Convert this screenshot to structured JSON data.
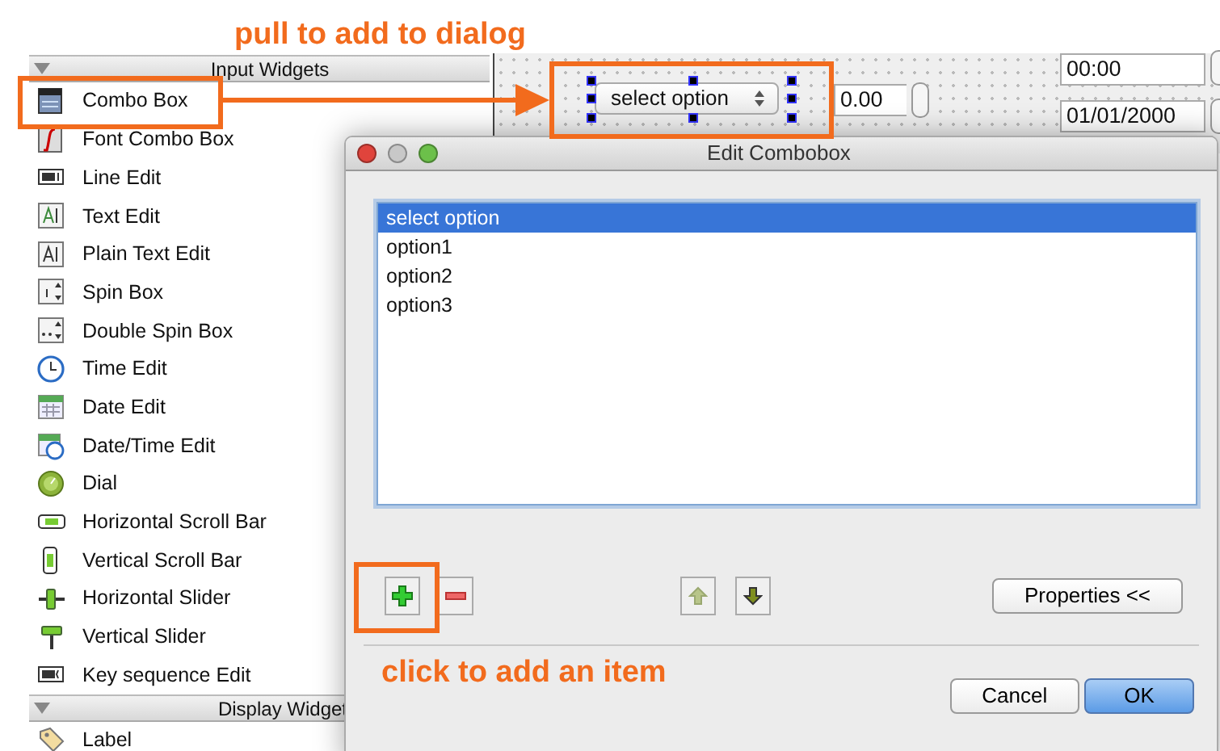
{
  "annotations": [
    {
      "text": "pull to add to dialog"
    },
    {
      "text": "click to add an item"
    }
  ],
  "widget_box": {
    "categories": [
      {
        "title": "Input Widgets",
        "expanded": true,
        "items": [
          "Combo Box",
          "Font Combo Box",
          "Line Edit",
          "Text Edit",
          "Plain Text Edit",
          "Spin Box",
          "Double Spin Box",
          "Time Edit",
          "Date Edit",
          "Date/Time Edit",
          "Dial",
          "Horizontal Scroll Bar",
          "Vertical Scroll Bar",
          "Horizontal Slider",
          "Vertical Slider",
          "Key sequence Edit"
        ]
      },
      {
        "title": "Display Widget",
        "expanded": true,
        "items": [
          "Label"
        ]
      }
    ]
  },
  "form": {
    "combo_box": "select option",
    "spin_box": "0.00",
    "time_edit": "00:00",
    "date_edit": "01/01/2000"
  },
  "dialog": {
    "title": "Edit Combobox",
    "items": [
      {
        "text": "select option",
        "selected": true
      },
      {
        "text": "option1",
        "selected": false
      },
      {
        "text": "option2",
        "selected": false
      },
      {
        "text": "option3",
        "selected": false
      }
    ],
    "properties_button": "Properties <<",
    "cancel_button": "Cancel",
    "ok_button": "OK"
  }
}
